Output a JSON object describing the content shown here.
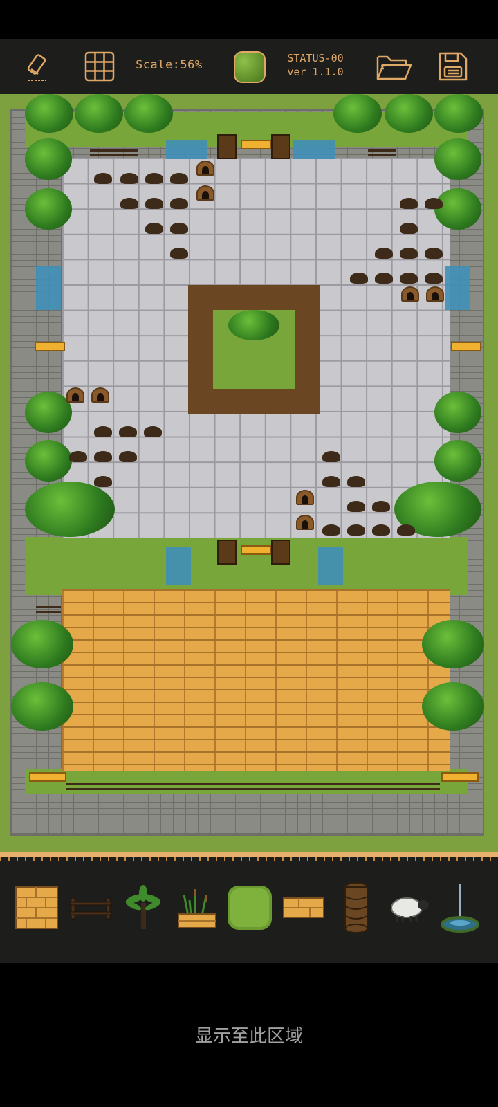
{
  "toolbar": {
    "scale_label": "Scale:56%",
    "status_line1": "STATUS-00",
    "status_line2": "ver 1.1.0",
    "icons": [
      "eraser-icon",
      "grid-icon",
      "grass-tile-icon",
      "folder-open-icon",
      "save-icon"
    ],
    "accent_color": "#e0a866"
  },
  "palette": {
    "items": [
      "wood-floor-tile",
      "fence",
      "palm-tree",
      "reed-planter",
      "grass-tile",
      "wood-plank",
      "log-pillar",
      "sheep",
      "fountain"
    ]
  },
  "bottom": {
    "link_label": "显示至此区域"
  }
}
